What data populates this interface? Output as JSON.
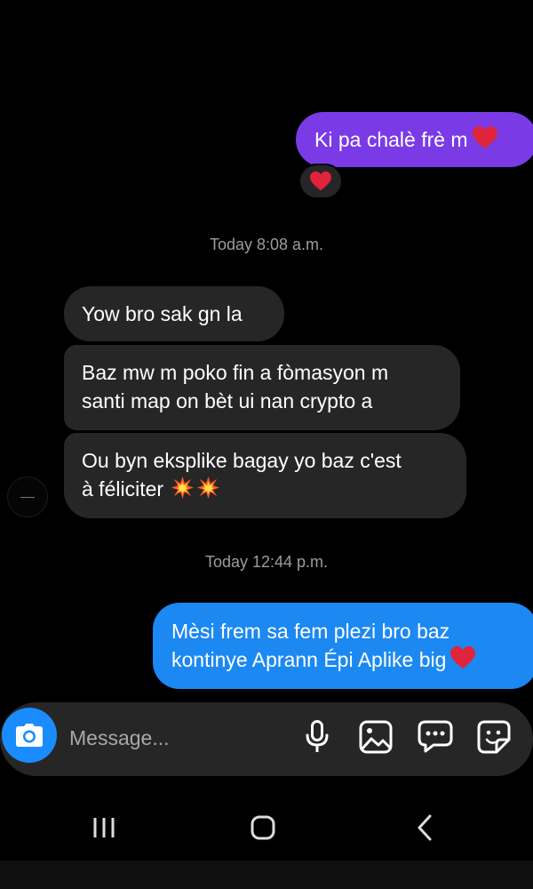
{
  "messages": {
    "outgoing_1": {
      "text": "Ki pa chalè frè m"
    },
    "reaction": "heart",
    "timestamp_1": "Today 8:08 a.m.",
    "incoming_1": "Yow bro sak gn la",
    "incoming_2_line1": "Baz mw m poko fin a fòmasyon m",
    "incoming_2_line2": "santi map on bèt ui nan crypto a",
    "incoming_3_line1": "Ou byn eksplike bagay yo baz c'est",
    "incoming_3_line2": "à féliciter",
    "timestamp_2": "Today 12:44 p.m.",
    "outgoing_2_line1": "Mèsi frem sa fem plezi bro baz",
    "outgoing_2_line2": "kontinye Aprann Épi Aplike big"
  },
  "composer": {
    "placeholder": "Message..."
  },
  "icons": {
    "camera": "camera-icon",
    "mic": "microphone-icon",
    "gallery": "image-icon",
    "chat": "chat-bubble-icon",
    "sticker": "sticker-icon",
    "recents": "recent-apps-icon",
    "home": "home-icon",
    "back": "back-icon"
  },
  "colors": {
    "purple_bubble": "#7a3be6",
    "blue_bubble": "#1c88f2",
    "incoming_bubble": "#262626",
    "heart": "#e0243b"
  }
}
